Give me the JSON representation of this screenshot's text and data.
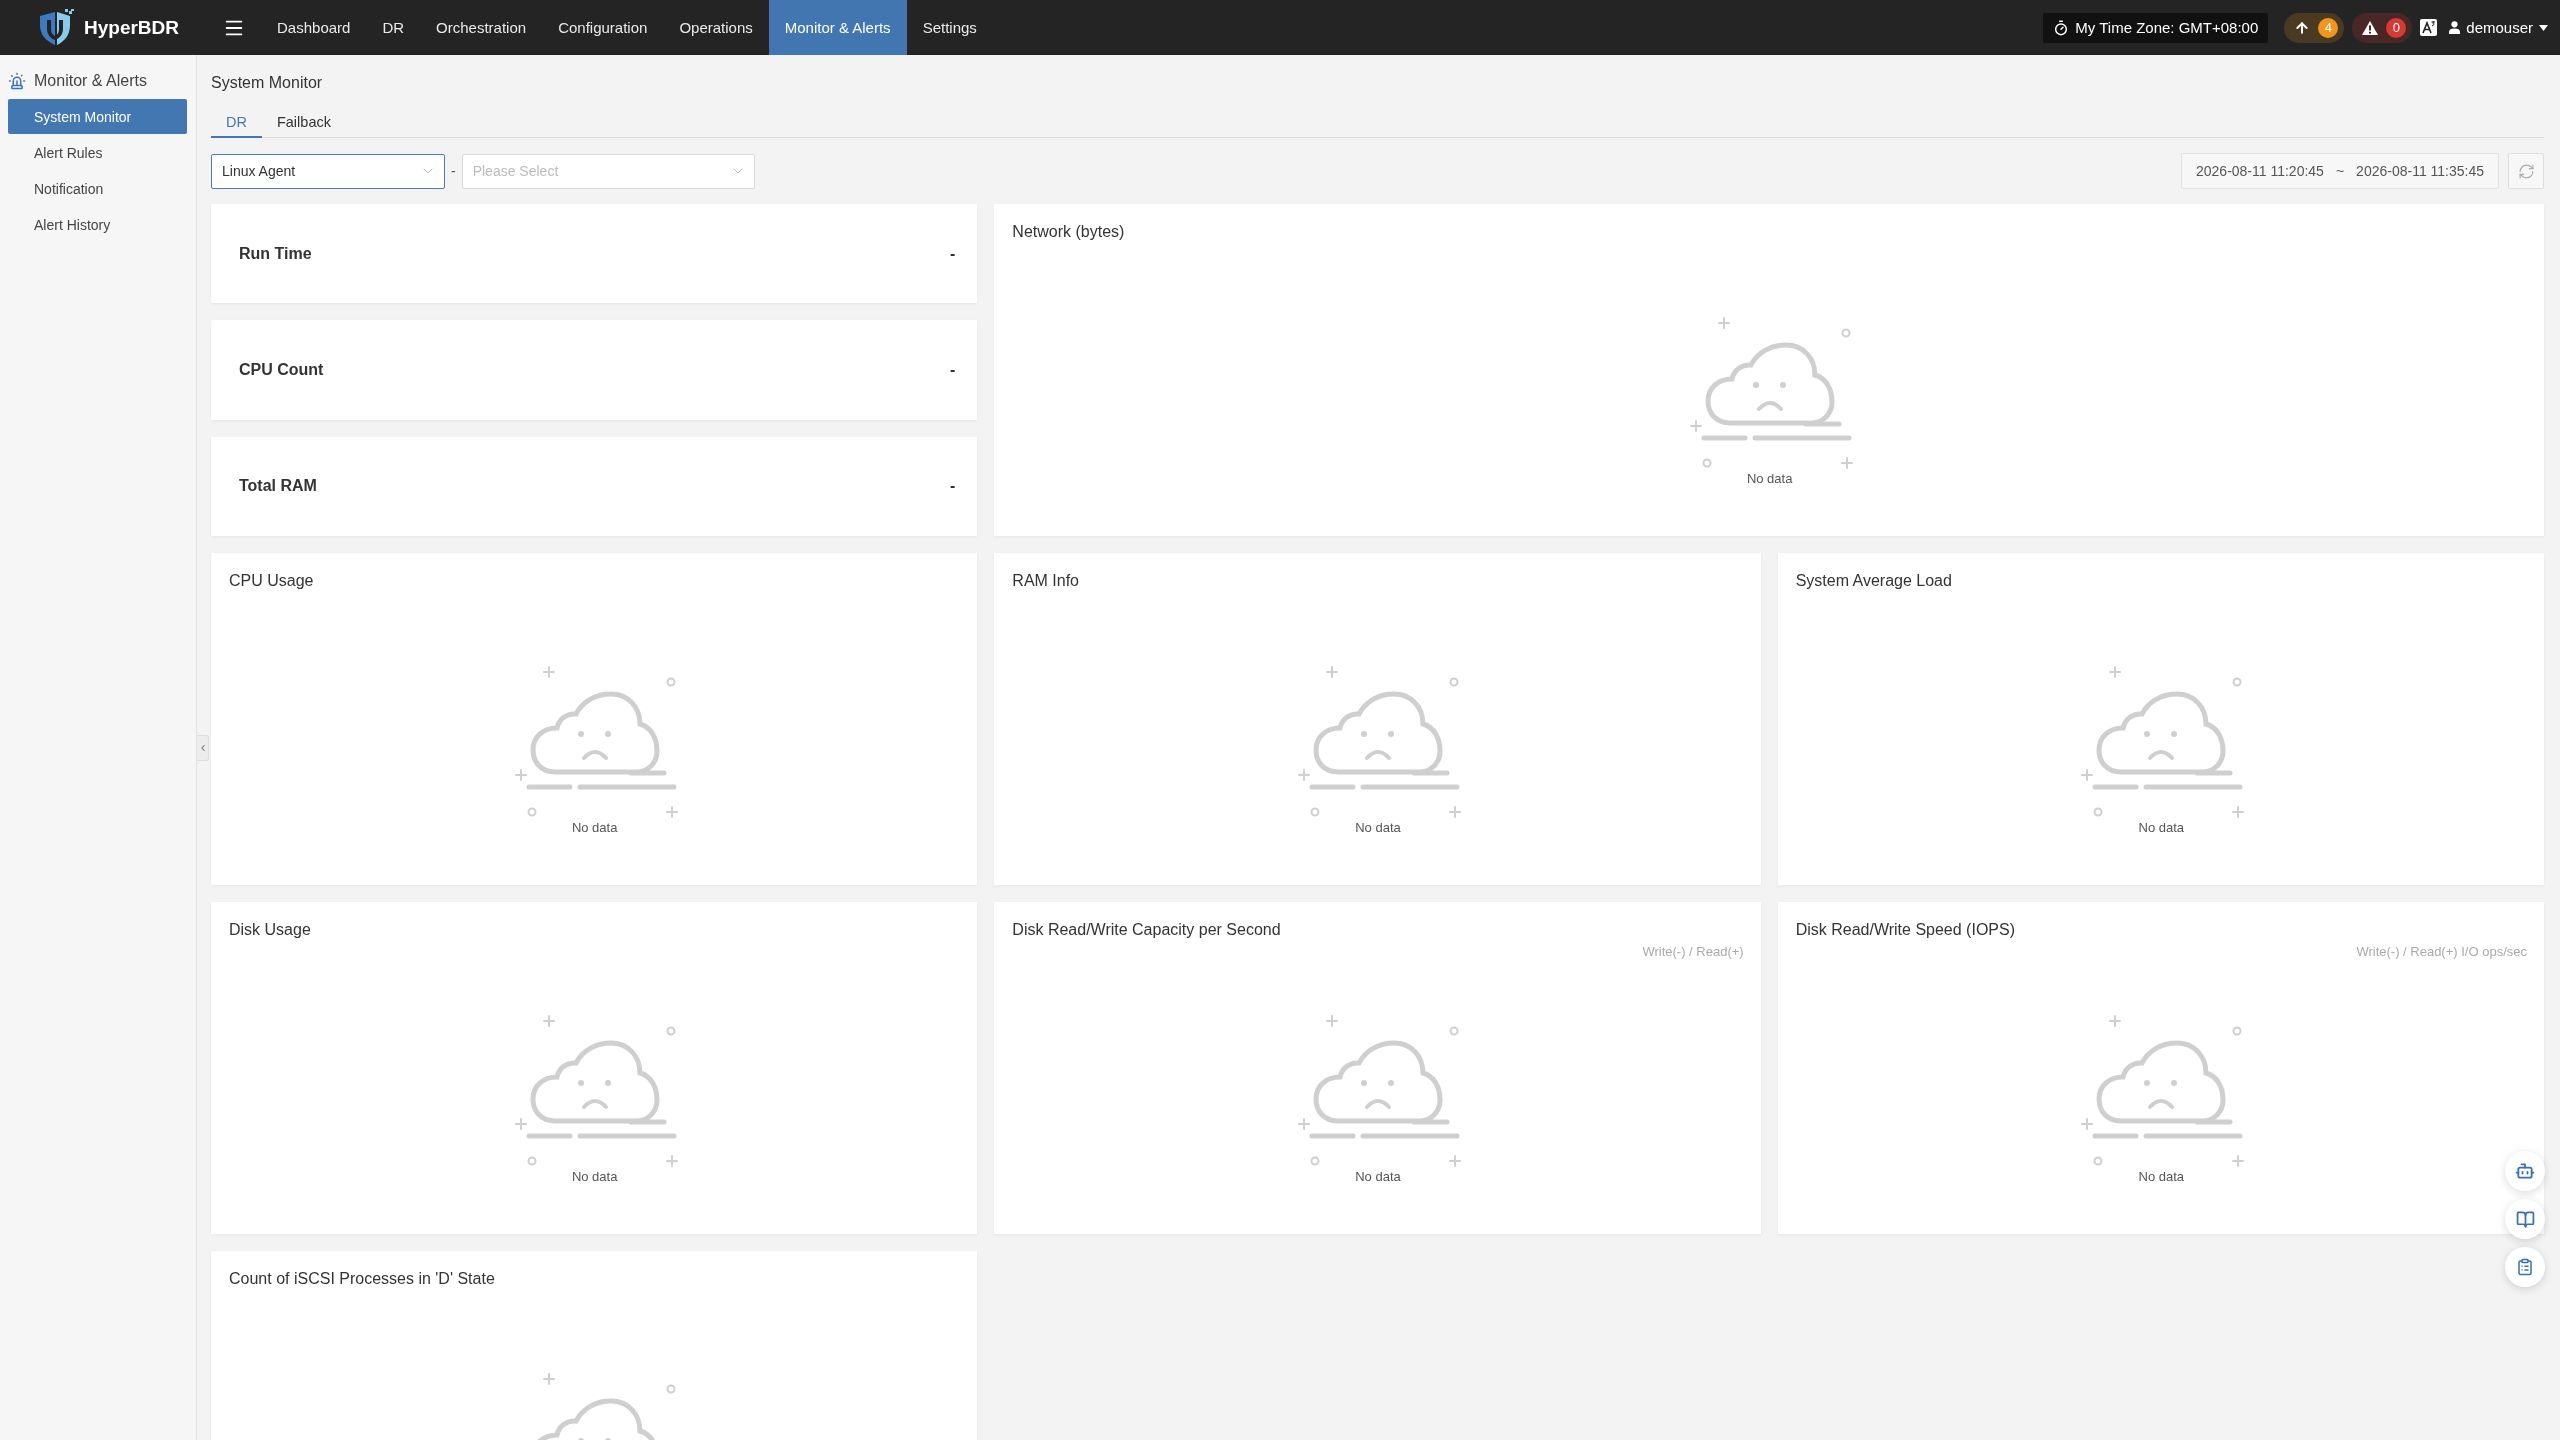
{
  "header": {
    "logo": "HyperBDR",
    "nav": [
      {
        "label": "Dashboard",
        "selected": false
      },
      {
        "label": "DR",
        "selected": false
      },
      {
        "label": "Orchestration",
        "selected": false
      },
      {
        "label": "Configuration",
        "selected": false
      },
      {
        "label": "Operations",
        "selected": false
      },
      {
        "label": "Monitor & Alerts",
        "selected": true
      },
      {
        "label": "Settings",
        "selected": false
      }
    ],
    "time_zone": "My Time Zone: GMT+08:00",
    "upload_count": "4",
    "alert_count": "0",
    "user": "demouser"
  },
  "sidebar": {
    "title": "Monitor & Alerts",
    "items": [
      {
        "label": "System Monitor",
        "selected": true
      },
      {
        "label": "Alert Rules",
        "selected": false
      },
      {
        "label": "Notification",
        "selected": false
      },
      {
        "label": "Alert History",
        "selected": false
      }
    ]
  },
  "page": {
    "title": "System Monitor",
    "tabs": [
      {
        "label": "DR",
        "selected": true
      },
      {
        "label": "Failback",
        "selected": false
      }
    ],
    "agent_type": {
      "value": "Linux Agent"
    },
    "filter_separator": "-",
    "agent": {
      "placeholder": "Please Select"
    },
    "time_range": {
      "start": "2026-08-11 11:20:45",
      "separator": "~",
      "end": "2026-08-11 11:35:45"
    }
  },
  "stats": [
    {
      "label": "Run Time",
      "value": "-"
    },
    {
      "label": "CPU Count",
      "value": "-"
    },
    {
      "label": "Total RAM",
      "value": "-"
    }
  ],
  "network_chart": {
    "title": "Network (bytes)",
    "empty_text": "No data"
  },
  "charts": [
    {
      "title": "CPU Usage",
      "empty_text": "No data"
    },
    {
      "title": "RAM Info",
      "empty_text": "No data"
    },
    {
      "title": "System Average Load",
      "empty_text": "No data"
    },
    {
      "title": "Disk Usage",
      "empty_text": "No data"
    },
    {
      "title": "Disk Read/Write Capacity per Second",
      "unit_note": "Write(-) / Read(+)",
      "empty_text": "No data"
    },
    {
      "title": "Disk Read/Write Speed (IOPS)",
      "unit_note": "Write(-) / Read(+) I/O ops/sec",
      "empty_text": "No data"
    },
    {
      "title": "Count of iSCSI Processes in 'D' State"
    }
  ]
}
